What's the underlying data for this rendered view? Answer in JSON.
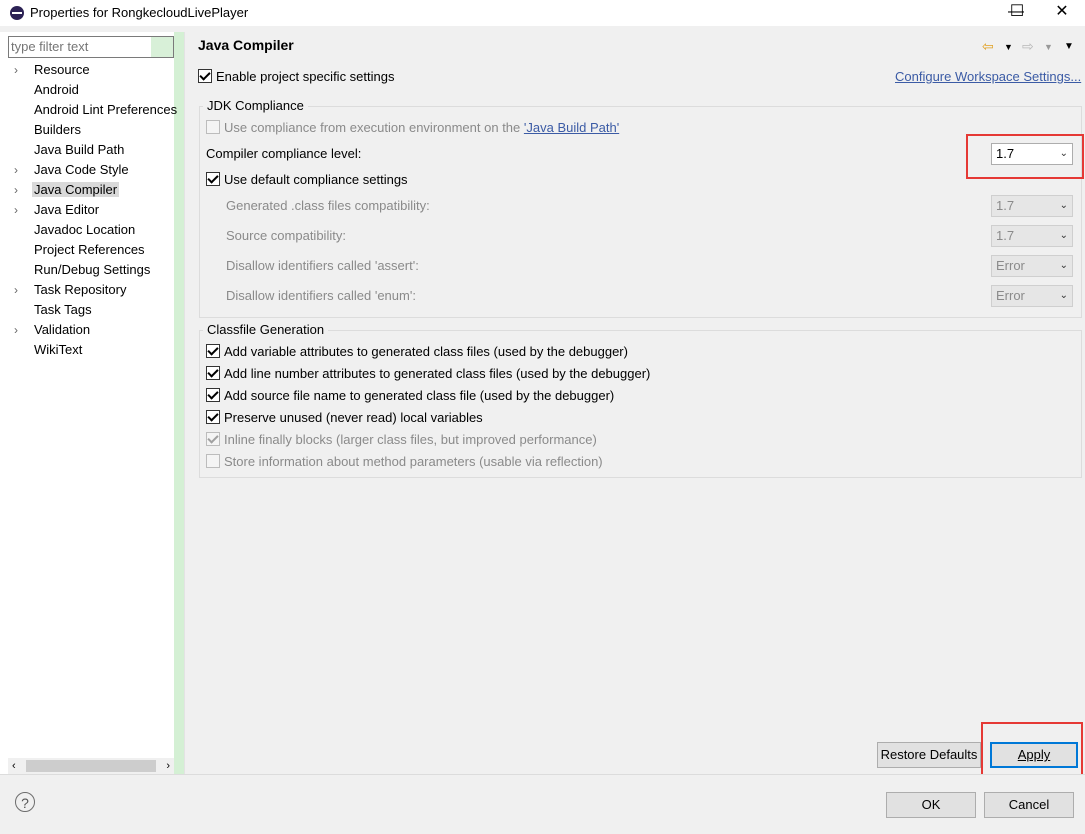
{
  "window": {
    "title": "Properties for RongkecloudLivePlayer",
    "minimize": "—",
    "maximize": "☐",
    "close": "✕"
  },
  "sidebar": {
    "filter_placeholder": "type filter text",
    "items": [
      {
        "label": "Resource",
        "expandable": true,
        "selected": false
      },
      {
        "label": "Android",
        "expandable": false,
        "selected": false
      },
      {
        "label": "Android Lint Preferences",
        "expandable": false,
        "selected": false
      },
      {
        "label": "Builders",
        "expandable": false,
        "selected": false
      },
      {
        "label": "Java Build Path",
        "expandable": false,
        "selected": false
      },
      {
        "label": "Java Code Style",
        "expandable": true,
        "selected": false
      },
      {
        "label": "Java Compiler",
        "expandable": true,
        "selected": true
      },
      {
        "label": "Java Editor",
        "expandable": true,
        "selected": false
      },
      {
        "label": "Javadoc Location",
        "expandable": false,
        "selected": false
      },
      {
        "label": "Project References",
        "expandable": false,
        "selected": false
      },
      {
        "label": "Run/Debug Settings",
        "expandable": false,
        "selected": false
      },
      {
        "label": "Task Repository",
        "expandable": true,
        "selected": false
      },
      {
        "label": "Task Tags",
        "expandable": false,
        "selected": false
      },
      {
        "label": "Validation",
        "expandable": true,
        "selected": false
      },
      {
        "label": "WikiText",
        "expandable": false,
        "selected": false
      }
    ]
  },
  "page": {
    "title": "Java Compiler",
    "enable_specific": {
      "label": "Enable project specific settings",
      "checked": true
    },
    "configure_link": "Configure Workspace Settings...",
    "jdk": {
      "group_title": "JDK Compliance",
      "use_env": {
        "label": "Use compliance from execution environment on the ",
        "link": "'Java Build Path'",
        "checked": false,
        "enabled": false
      },
      "level_label": "Compiler compliance level:",
      "level_value": "1.7",
      "use_default": {
        "label": "Use default compliance settings",
        "checked": true
      },
      "rows": [
        {
          "label": "Generated .class files compatibility:",
          "value": "1.7"
        },
        {
          "label": "Source compatibility:",
          "value": "1.7"
        },
        {
          "label": "Disallow identifiers called 'assert':",
          "value": "Error"
        },
        {
          "label": "Disallow identifiers called 'enum':",
          "value": "Error"
        }
      ]
    },
    "classfile": {
      "group_title": "Classfile Generation",
      "options": [
        {
          "label": "Add variable attributes to generated class files (used by the debugger)",
          "checked": true,
          "enabled": true
        },
        {
          "label": "Add line number attributes to generated class files (used by the debugger)",
          "checked": true,
          "enabled": true
        },
        {
          "label": "Add source file name to generated class file (used by the debugger)",
          "checked": true,
          "enabled": true
        },
        {
          "label": "Preserve unused (never read) local variables",
          "checked": true,
          "enabled": true
        },
        {
          "label": "Inline finally blocks (larger class files, but improved performance)",
          "checked": true,
          "enabled": false
        },
        {
          "label": "Store information about method parameters (usable via reflection)",
          "checked": false,
          "enabled": false
        }
      ]
    },
    "restore_defaults": "Restore Defaults",
    "apply": "Apply"
  },
  "footer": {
    "help": "?",
    "ok": "OK",
    "cancel": "Cancel"
  },
  "colors": {
    "highlight_box": "#e53935",
    "default_button_border": "#0078d7",
    "link": "#3b5ba5"
  }
}
